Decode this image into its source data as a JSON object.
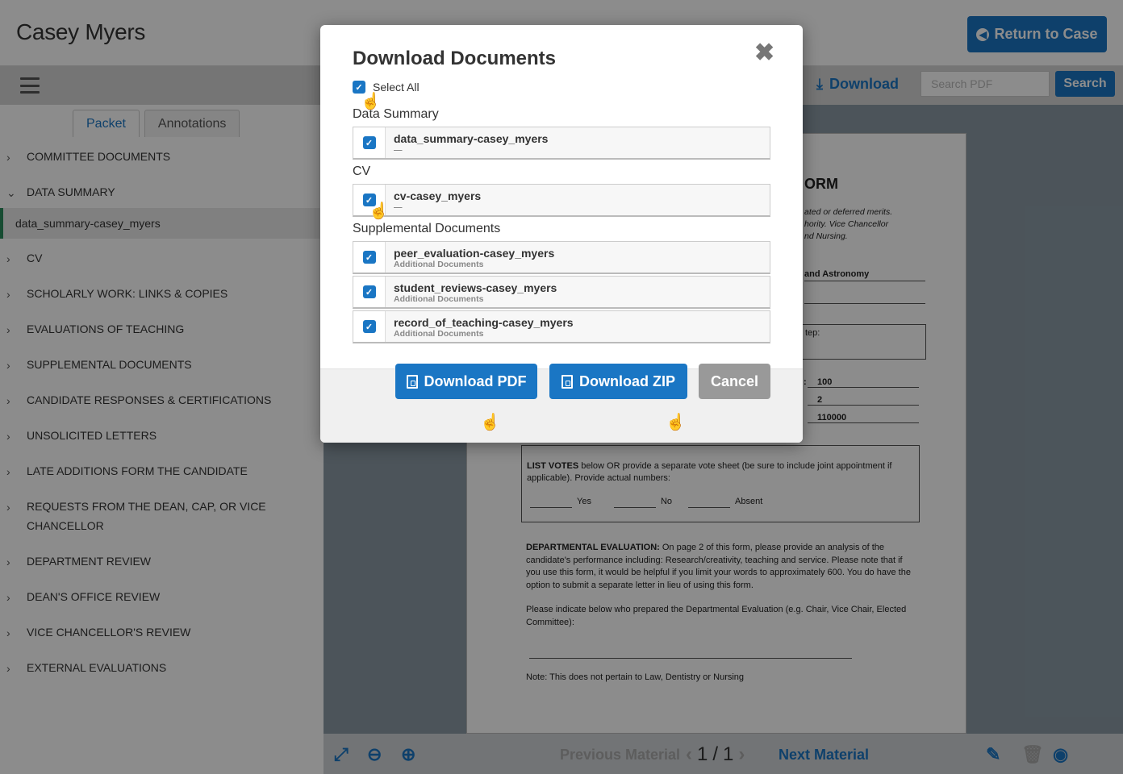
{
  "header": {
    "name": "Casey Myers",
    "return_label": "Return to Case"
  },
  "toolbar": {
    "download_label": "Download",
    "search_placeholder": "Search PDF",
    "search_label": "Search"
  },
  "tabs": [
    {
      "label": "Packet"
    },
    {
      "label": "Annotations"
    }
  ],
  "nav": {
    "committee": "COMMITTEE DOCUMENTS",
    "data_summary": "DATA SUMMARY",
    "data_summary_doc": "data_summary-casey_myers",
    "cv": "CV",
    "scholarly": "SCHOLARLY WORK: LINKS & COPIES",
    "teaching": "EVALUATIONS OF TEACHING",
    "supplemental": "SUPPLEMENTAL DOCUMENTS",
    "responses": "CANDIDATE RESPONSES & CERTIFICATIONS",
    "unsolicited": "UNSOLICITED LETTERS",
    "late": "LATE ADDITIONS FORM THE CANDIDATE",
    "requests": "REQUESTS FROM THE DEAN, CAP, OR VICE CHANCELLOR",
    "dept_review": "DEPARTMENT REVIEW",
    "dean_review": "DEAN'S OFFICE REVIEW",
    "vc_review": "VICE CHANCELLOR'S REVIEW",
    "external": "EXTERNAL EVALUATIONS"
  },
  "document": {
    "title_fragment": "ORM",
    "italic_lines": [
      "ated or deferred merits.",
      "hority.  Vice Chancellor",
      "nd Nursing."
    ],
    "dept": "and Astronomy",
    "box_label": "tep:",
    "val1": "100",
    "val2": "2",
    "val3": "110000",
    "votes_bold": "LIST VOTES",
    "votes_text": " below OR provide a separate vote sheet (be sure to include joint appointment if applicable).   Provide actual numbers:",
    "yes": "Yes",
    "no": "No",
    "absent": "Absent",
    "eval_bold": "DEPARTMENTAL EVALUATION:",
    "eval_text": "  On page 2 of this form, please provide an analysis of the candidate's performance including:  Research/creativity, teaching and service.  Please note that if you use this form, it would be helpful if you limit your words to approximately 600.  You do have the option to submit a separate letter in lieu of using this form.",
    "prepared": "Please indicate below who prepared the Departmental Evaluation (e.g. Chair, Vice Chair, Elected Committee):",
    "note": "Note:  This does not pertain to Law, Dentistry or Nursing"
  },
  "bottombar": {
    "prev": "Previous Material",
    "page": "1",
    "sep": "/",
    "total": "1",
    "next": "Next Material"
  },
  "modal": {
    "title": "Download Documents",
    "select_all": "Select All",
    "sections": {
      "data_summary": "Data Summary",
      "cv": "CV",
      "supplemental": "Supplemental Documents"
    },
    "docs": [
      {
        "name": "data_summary-casey_myers",
        "sub": "—"
      },
      {
        "name": "cv-casey_myers",
        "sub": "—"
      },
      {
        "name": "peer_evaluation-casey_myers",
        "sub": "Additional Documents"
      },
      {
        "name": "student_reviews-casey_myers",
        "sub": "Additional Documents"
      },
      {
        "name": "record_of_teaching-casey_myers",
        "sub": "Additional Documents"
      }
    ],
    "download_pdf": "Download PDF",
    "download_zip": "Download ZIP",
    "cancel": "Cancel"
  },
  "icons": {
    "chevron_right": "›",
    "chevron_down": "⌄",
    "check": "✓",
    "close": "✖",
    "hand_cursor": "☝"
  },
  "colors": {
    "accent": "#1a76c4",
    "nav_active": "#2a8b5c",
    "cancel": "#999999"
  }
}
